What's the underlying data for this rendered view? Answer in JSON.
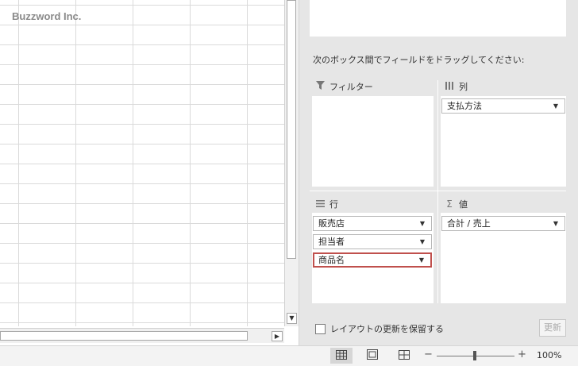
{
  "sheet": {
    "watermark": "Buzzword Inc."
  },
  "scrollbars": {
    "down_arrow": "▼",
    "right_arrow": "▶"
  },
  "pivot_pane": {
    "instruction": "次のボックス間でフィールドをドラッグしてください:",
    "areas": {
      "filter": {
        "icon": "filter-icon",
        "label": "フィルター",
        "fields": []
      },
      "columns": {
        "icon": "columns-icon",
        "label": "列",
        "fields": [
          "支払方法"
        ]
      },
      "rows": {
        "icon": "rows-icon",
        "label": "行",
        "fields": [
          "販売店",
          "担当者",
          "商品名"
        ],
        "selected_index": 2
      },
      "values": {
        "icon": "sigma-icon",
        "label": "値",
        "fields": [
          "合計 / 売上"
        ]
      }
    },
    "defer_update_label": "レイアウトの更新を保留する",
    "defer_update_checked": false,
    "update_button_label": "更新"
  },
  "statusbar": {
    "views": [
      "normal-view-icon",
      "page-layout-icon",
      "page-break-preview-icon"
    ],
    "active_view": "normal-view-icon",
    "zoom_minus": "−",
    "zoom_plus": "+",
    "zoom": "100%"
  },
  "colors": {
    "selected_border": "#c0504d",
    "pane_bg": "#e6e6e6"
  }
}
